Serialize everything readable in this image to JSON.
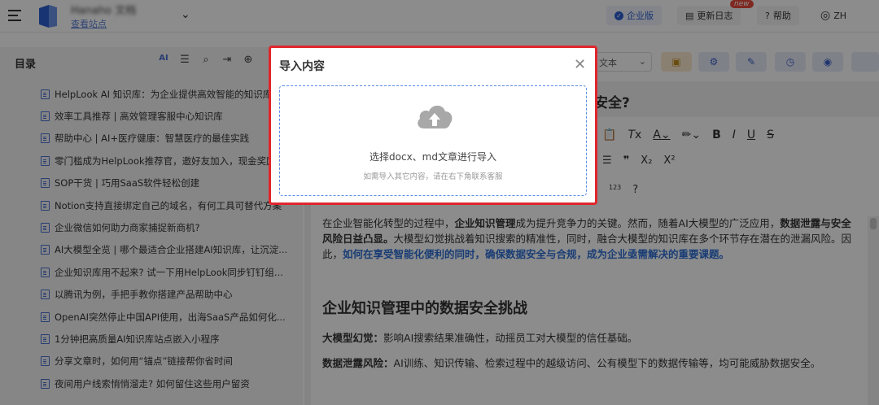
{
  "header": {
    "site_name": "Hanaho 文档",
    "site_link": "查看站点",
    "enterprise": "企业版",
    "update_log": "更新日志",
    "new_badge": "new",
    "help": "帮助",
    "lang": "ZH"
  },
  "sidebar": {
    "title": "目录",
    "items": [
      {
        "label": "HelpLook AI 知识库：为企业提供高效智能的知识库"
      },
      {
        "label": "效率工具推荐 | 高效管理客服中心知识库"
      },
      {
        "label": "帮助中心 | AI+医疗健康：智慧医疗的最佳实践"
      },
      {
        "label": "零门槛成为HelpLook推荐官，邀好友加入，现金奖励"
      },
      {
        "label": "SOP干货 | 巧用SaaS软件轻松创建"
      },
      {
        "label": "Notion支持直接绑定自己的域名，有何工具可替代方案"
      },
      {
        "label": "企业微信如何助力商家捕捉新商机?"
      },
      {
        "label": "AI大模型全览 | 哪个最适合企业搭建AI知识库，让沉淀..."
      },
      {
        "label": "企业知识库用不起来? 试一下用HelpLook同步钉钉组..."
      },
      {
        "label": "以腾讯为例，手把手教你搭建产品帮助中心"
      },
      {
        "label": "OpenAI突然停止中国API使用，出海SaaS产品如何化..."
      },
      {
        "label": "1分钟把高质量AI知识库站点嵌入小程序"
      },
      {
        "label": "分享文章时，如何用“锚点”链接帮你省时间"
      },
      {
        "label": "夜间用户线索悄悄溜走? 如何留住这些用户留资"
      }
    ]
  },
  "editor": {
    "body_select": "文本",
    "title_suffix": "安全?",
    "para1_a": "在企业智能化转型的过程中，",
    "para1_b": "企业知识管理",
    "para1_c": "成为提升竞争力的关键。然而，随着AI大模型的广泛应用，",
    "para1_d": "数据泄露与安全风险日益凸显。",
    "para1_e": "大模型幻觉挑战着知识搜索的精准性，同时，融合大模型的知识库在多个环节存在潜在的泄漏风险。因此，",
    "para1_f": "如何在享受智能化便利的同时，确保数据安全与合规，成为企业亟需解决的重要课题。",
    "heading": "企业知识管理中的数据安全挑战",
    "p2_label": "大模型幻觉：",
    "p2_text": "影响AI搜索结果准确性，动摇员工对大模型的信任基础。",
    "p3_label": "数据泄露风险：",
    "p3_text": "AI训练、知识传输、检索过程中的越级访问、公有模型下的数据传输等，均可能威胁数据安全。"
  },
  "modal": {
    "title": "导入内容",
    "dropzone_text": "选择docx、md文章进行导入",
    "dropzone_hint": "如需导入其它内容，请在右下角联系客服"
  },
  "colors": {
    "accent": "#2f5fd1",
    "modal_border": "#e0262c",
    "overlay": "rgba(0,0,0,0.45)"
  }
}
